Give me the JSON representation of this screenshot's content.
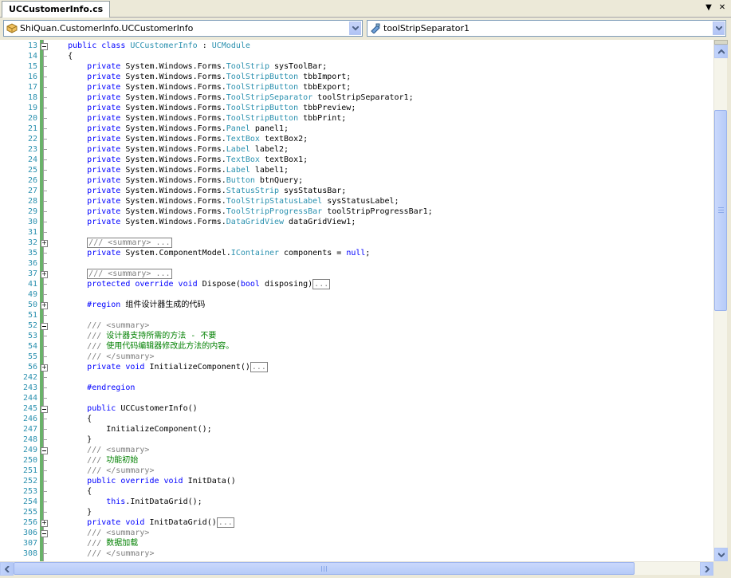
{
  "tab": {
    "title": "UCCustomerInfo.cs"
  },
  "tab_controls": {
    "dropdown": "▼",
    "close": "✕"
  },
  "nav": {
    "class_combo": "ShiQuan.CustomerInfo.UCCustomerInfo",
    "member_combo": "toolStripSeparator1"
  },
  "lines": [
    {
      "num": "13",
      "fold": "minus",
      "segs": [
        {
          "t": "    "
        },
        {
          "t": "public class ",
          "c": "kw"
        },
        {
          "t": "UCCustomerInfo",
          "c": "ty"
        },
        {
          "t": " : "
        },
        {
          "t": "UCModule",
          "c": "ty"
        }
      ]
    },
    {
      "num": "14",
      "segs": [
        {
          "t": "    {"
        }
      ]
    },
    {
      "num": "15",
      "segs": [
        {
          "t": "        "
        },
        {
          "t": "private ",
          "c": "kw"
        },
        {
          "t": "System.Windows.Forms."
        },
        {
          "t": "ToolStrip",
          "c": "ty"
        },
        {
          "t": " sysToolBar;"
        }
      ]
    },
    {
      "num": "16",
      "segs": [
        {
          "t": "        "
        },
        {
          "t": "private ",
          "c": "kw"
        },
        {
          "t": "System.Windows.Forms."
        },
        {
          "t": "ToolStripButton",
          "c": "ty"
        },
        {
          "t": " tbbImport;"
        }
      ]
    },
    {
      "num": "17",
      "segs": [
        {
          "t": "        "
        },
        {
          "t": "private ",
          "c": "kw"
        },
        {
          "t": "System.Windows.Forms."
        },
        {
          "t": "ToolStripButton",
          "c": "ty"
        },
        {
          "t": " tbbExport;"
        }
      ]
    },
    {
      "num": "18",
      "segs": [
        {
          "t": "        "
        },
        {
          "t": "private ",
          "c": "kw"
        },
        {
          "t": "System.Windows.Forms."
        },
        {
          "t": "ToolStripSeparator",
          "c": "ty"
        },
        {
          "t": " toolStripSeparator1;"
        }
      ]
    },
    {
      "num": "19",
      "segs": [
        {
          "t": "        "
        },
        {
          "t": "private ",
          "c": "kw"
        },
        {
          "t": "System.Windows.Forms."
        },
        {
          "t": "ToolStripButton",
          "c": "ty"
        },
        {
          "t": " tbbPreview;"
        }
      ]
    },
    {
      "num": "20",
      "segs": [
        {
          "t": "        "
        },
        {
          "t": "private ",
          "c": "kw"
        },
        {
          "t": "System.Windows.Forms."
        },
        {
          "t": "ToolStripButton",
          "c": "ty"
        },
        {
          "t": " tbbPrint;"
        }
      ]
    },
    {
      "num": "21",
      "segs": [
        {
          "t": "        "
        },
        {
          "t": "private ",
          "c": "kw"
        },
        {
          "t": "System.Windows.Forms."
        },
        {
          "t": "Panel",
          "c": "ty"
        },
        {
          "t": " panel1;"
        }
      ]
    },
    {
      "num": "22",
      "segs": [
        {
          "t": "        "
        },
        {
          "t": "private ",
          "c": "kw"
        },
        {
          "t": "System.Windows.Forms."
        },
        {
          "t": "TextBox",
          "c": "ty"
        },
        {
          "t": " textBox2;"
        }
      ]
    },
    {
      "num": "23",
      "segs": [
        {
          "t": "        "
        },
        {
          "t": "private ",
          "c": "kw"
        },
        {
          "t": "System.Windows.Forms."
        },
        {
          "t": "Label",
          "c": "ty"
        },
        {
          "t": " label2;"
        }
      ]
    },
    {
      "num": "24",
      "segs": [
        {
          "t": "        "
        },
        {
          "t": "private ",
          "c": "kw"
        },
        {
          "t": "System.Windows.Forms."
        },
        {
          "t": "TextBox",
          "c": "ty"
        },
        {
          "t": " textBox1;"
        }
      ]
    },
    {
      "num": "25",
      "segs": [
        {
          "t": "        "
        },
        {
          "t": "private ",
          "c": "kw"
        },
        {
          "t": "System.Windows.Forms."
        },
        {
          "t": "Label",
          "c": "ty"
        },
        {
          "t": " label1;"
        }
      ]
    },
    {
      "num": "26",
      "segs": [
        {
          "t": "        "
        },
        {
          "t": "private ",
          "c": "kw"
        },
        {
          "t": "System.Windows.Forms."
        },
        {
          "t": "Button",
          "c": "ty"
        },
        {
          "t": " btnQuery;"
        }
      ]
    },
    {
      "num": "27",
      "segs": [
        {
          "t": "        "
        },
        {
          "t": "private ",
          "c": "kw"
        },
        {
          "t": "System.Windows.Forms."
        },
        {
          "t": "StatusStrip",
          "c": "ty"
        },
        {
          "t": " sysStatusBar;"
        }
      ]
    },
    {
      "num": "28",
      "segs": [
        {
          "t": "        "
        },
        {
          "t": "private ",
          "c": "kw"
        },
        {
          "t": "System.Windows.Forms."
        },
        {
          "t": "ToolStripStatusLabel",
          "c": "ty"
        },
        {
          "t": " sysStatusLabel;"
        }
      ]
    },
    {
      "num": "29",
      "segs": [
        {
          "t": "        "
        },
        {
          "t": "private ",
          "c": "kw"
        },
        {
          "t": "System.Windows.Forms."
        },
        {
          "t": "ToolStripProgressBar",
          "c": "ty"
        },
        {
          "t": " toolStripProgressBar1;"
        }
      ]
    },
    {
      "num": "30",
      "segs": [
        {
          "t": "        "
        },
        {
          "t": "private ",
          "c": "kw"
        },
        {
          "t": "System.Windows.Forms."
        },
        {
          "t": "DataGridView",
          "c": "ty"
        },
        {
          "t": " dataGridView1;"
        }
      ]
    },
    {
      "num": "31",
      "segs": []
    },
    {
      "num": "32",
      "fold": "plus",
      "segs": [
        {
          "t": "        "
        },
        {
          "t": "/// <summary> ...",
          "c": "box"
        }
      ]
    },
    {
      "num": "35",
      "segs": [
        {
          "t": "        "
        },
        {
          "t": "private ",
          "c": "kw"
        },
        {
          "t": "System.ComponentModel."
        },
        {
          "t": "IContainer",
          "c": "ty"
        },
        {
          "t": " components = "
        },
        {
          "t": "null",
          "c": "kw"
        },
        {
          "t": ";"
        }
      ]
    },
    {
      "num": "36",
      "segs": []
    },
    {
      "num": "37",
      "fold": "plus",
      "segs": [
        {
          "t": "        "
        },
        {
          "t": "/// <summary> ...",
          "c": "box"
        }
      ]
    },
    {
      "num": "41",
      "segs": [
        {
          "t": "        "
        },
        {
          "t": "protected override void ",
          "c": "kw"
        },
        {
          "t": "Dispose("
        },
        {
          "t": "bool",
          "c": "kw"
        },
        {
          "t": " disposing)"
        },
        {
          "t": "...",
          "c": "box"
        }
      ]
    },
    {
      "num": "49",
      "segs": []
    },
    {
      "num": "50",
      "fold": "plus",
      "segs": [
        {
          "t": "        "
        },
        {
          "t": "#region ",
          "c": "kw"
        },
        {
          "t": "组件设计器生成的代码"
        }
      ]
    },
    {
      "num": "51",
      "segs": []
    },
    {
      "num": "52",
      "fold": "minus",
      "segs": [
        {
          "t": "        "
        },
        {
          "t": "/// ",
          "c": "gr"
        },
        {
          "t": "<summary>",
          "c": "gr"
        }
      ]
    },
    {
      "num": "53",
      "segs": [
        {
          "t": "        "
        },
        {
          "t": "/// ",
          "c": "gr"
        },
        {
          "t": "设计器支持所需的方法 - 不要",
          "c": "cm"
        }
      ]
    },
    {
      "num": "54",
      "segs": [
        {
          "t": "        "
        },
        {
          "t": "/// ",
          "c": "gr"
        },
        {
          "t": "使用代码编辑器修改此方法的内容。",
          "c": "cm"
        }
      ]
    },
    {
      "num": "55",
      "segs": [
        {
          "t": "        "
        },
        {
          "t": "/// </summary>",
          "c": "gr"
        }
      ]
    },
    {
      "num": "56",
      "fold": "plus",
      "segs": [
        {
          "t": "        "
        },
        {
          "t": "private void ",
          "c": "kw"
        },
        {
          "t": "InitializeComponent()"
        },
        {
          "t": "...",
          "c": "box"
        }
      ]
    },
    {
      "num": "242",
      "segs": []
    },
    {
      "num": "243",
      "segs": [
        {
          "t": "        "
        },
        {
          "t": "#endregion",
          "c": "kw"
        }
      ]
    },
    {
      "num": "244",
      "segs": []
    },
    {
      "num": "245",
      "fold": "minus",
      "segs": [
        {
          "t": "        "
        },
        {
          "t": "public ",
          "c": "kw"
        },
        {
          "t": "UCCustomerInfo()"
        }
      ]
    },
    {
      "num": "246",
      "segs": [
        {
          "t": "        {"
        }
      ]
    },
    {
      "num": "247",
      "segs": [
        {
          "t": "            InitializeComponent();"
        }
      ]
    },
    {
      "num": "248",
      "segs": [
        {
          "t": "        }"
        }
      ]
    },
    {
      "num": "249",
      "fold": "minus",
      "segs": [
        {
          "t": "        "
        },
        {
          "t": "/// <summary>",
          "c": "gr"
        }
      ]
    },
    {
      "num": "250",
      "segs": [
        {
          "t": "        "
        },
        {
          "t": "/// ",
          "c": "gr"
        },
        {
          "t": "功能初始",
          "c": "cm"
        }
      ]
    },
    {
      "num": "251",
      "segs": [
        {
          "t": "        "
        },
        {
          "t": "/// </summary>",
          "c": "gr"
        }
      ]
    },
    {
      "num": "252",
      "segs": [
        {
          "t": "        "
        },
        {
          "t": "public override void ",
          "c": "kw"
        },
        {
          "t": "InitData()"
        }
      ]
    },
    {
      "num": "253",
      "segs": [
        {
          "t": "        {"
        }
      ]
    },
    {
      "num": "254",
      "segs": [
        {
          "t": "            "
        },
        {
          "t": "this",
          "c": "kw"
        },
        {
          "t": ".InitDataGrid();"
        }
      ]
    },
    {
      "num": "255",
      "segs": [
        {
          "t": "        }"
        }
      ]
    },
    {
      "num": "256",
      "fold": "plus",
      "segs": [
        {
          "t": "        "
        },
        {
          "t": "private void ",
          "c": "kw"
        },
        {
          "t": "InitDataGrid()"
        },
        {
          "t": "...",
          "c": "box"
        }
      ]
    },
    {
      "num": "306",
      "fold": "minus",
      "segs": [
        {
          "t": "        "
        },
        {
          "t": "/// <summary>",
          "c": "gr"
        }
      ]
    },
    {
      "num": "307",
      "segs": [
        {
          "t": "        "
        },
        {
          "t": "/// ",
          "c": "gr"
        },
        {
          "t": "数据加载",
          "c": "cm"
        }
      ]
    },
    {
      "num": "308",
      "segs": [
        {
          "t": "        "
        },
        {
          "t": "/// </summary>",
          "c": "gr"
        }
      ]
    }
  ],
  "colors": {
    "keyword": "#0000ff",
    "type": "#2b91af",
    "comment": "#008000",
    "doc": "#808080",
    "changebar": "#6ab26a"
  }
}
